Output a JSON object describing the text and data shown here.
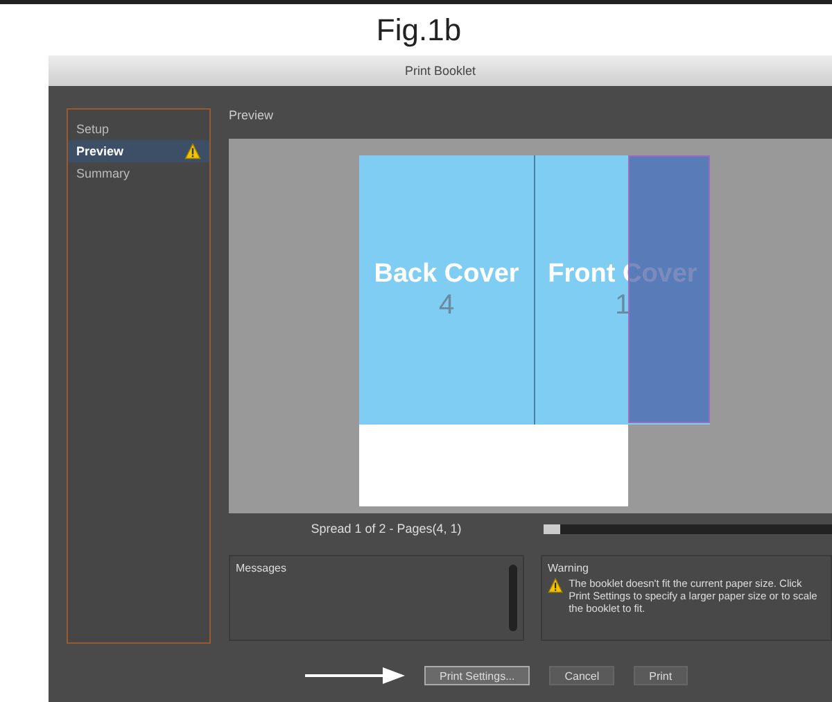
{
  "caption": "Fig.1b",
  "window": {
    "title": "Print Booklet"
  },
  "sidebar": {
    "items": [
      {
        "label": "Setup",
        "selected": false,
        "warning": false
      },
      {
        "label": "Preview",
        "selected": true,
        "warning": true
      },
      {
        "label": "Summary",
        "selected": false,
        "warning": false
      }
    ]
  },
  "section_title": "Preview",
  "preview": {
    "back": {
      "label": "Back Cover",
      "page": "4"
    },
    "front": {
      "label": "Front Cover",
      "page": "1"
    }
  },
  "spread_info": "Spread 1 of 2 - Pages(4, 1)",
  "messages": {
    "label": "Messages"
  },
  "warning": {
    "label": "Warning",
    "text": "The booklet doesn't fit the current paper size. Click Print Settings to specify a larger paper size or to scale the booklet to fit."
  },
  "buttons": [
    {
      "label": "Print Settings...",
      "highlighted": true
    },
    {
      "label": "Cancel",
      "highlighted": false
    },
    {
      "label": "Print",
      "highlighted": false
    }
  ]
}
